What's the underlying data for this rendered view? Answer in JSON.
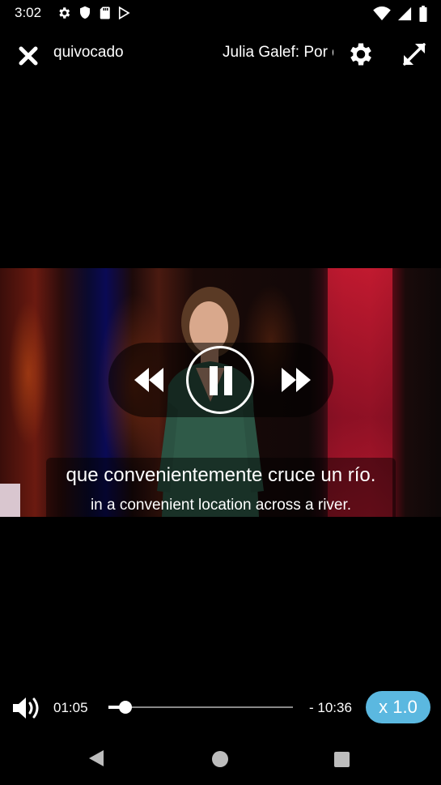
{
  "status_bar": {
    "time": "3:02",
    "left_icons": [
      "gear-icon",
      "shield-icon",
      "sd-card-icon",
      "play-store-icon"
    ],
    "right_icons": [
      "wifi-icon",
      "cell-signal-icon",
      "battery-icon"
    ]
  },
  "header": {
    "title_fragment_left": "quivocado",
    "title_fragment_right": "Julia Galef: Por q",
    "icons": [
      "close-icon",
      "settings-icon",
      "fullscreen-icon"
    ]
  },
  "player": {
    "icons": [
      "rewind-icon",
      "pause-icon",
      "fast-forward-icon"
    ],
    "subtitle_primary": "que convenientemente cruce un río.",
    "subtitle_secondary": "in a convenient location across a river."
  },
  "bottom_controls": {
    "current_time": "01:05",
    "remaining_time": "- 10:36",
    "progress_fraction": 0.09,
    "speed_label": "x 1.0",
    "speed_color": "#5bb8e0",
    "icons": [
      "volume-icon"
    ]
  },
  "nav_bar": {
    "icons": [
      "back-icon",
      "home-icon",
      "recents-icon"
    ]
  }
}
